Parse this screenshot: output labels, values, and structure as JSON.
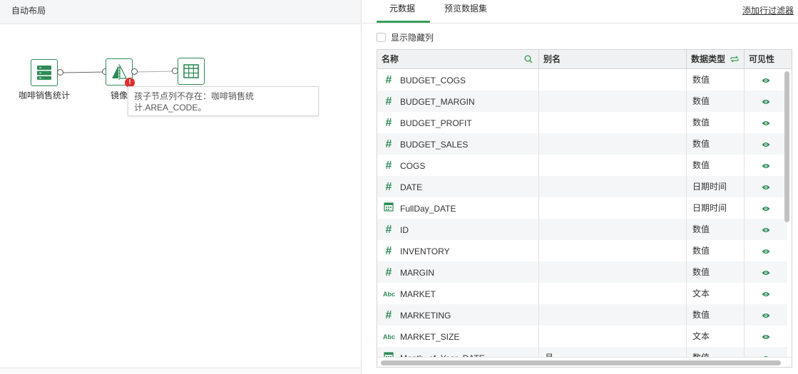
{
  "left_panel": {
    "title": "自动布局",
    "nodes": [
      {
        "label": "咖啡销售统计",
        "icon": "table-source-icon"
      },
      {
        "label": "镜像",
        "icon": "mirror-icon"
      },
      {
        "label": "",
        "icon": "output-table-icon"
      }
    ],
    "error_badge": "!",
    "tooltip": {
      "line1": "孩子节点列不存在：咖啡销售统",
      "line2": "计.AREA_CODE。"
    }
  },
  "right_panel": {
    "tabs": [
      {
        "label": "元数据",
        "active": true
      },
      {
        "label": "预览数据集",
        "active": false
      }
    ],
    "add_filter_link": "添加行过滤器",
    "show_hidden_label": "显示隐藏列",
    "table": {
      "headers": {
        "name": "名称",
        "alias": "别名",
        "type": "数据类型",
        "visible": "可见性"
      },
      "rows": [
        {
          "icon": "number",
          "name": "BUDGET_COGS",
          "alias": "",
          "type": "数值"
        },
        {
          "icon": "number",
          "name": "BUDGET_MARGIN",
          "alias": "",
          "type": "数值"
        },
        {
          "icon": "number",
          "name": "BUDGET_PROFIT",
          "alias": "",
          "type": "数值"
        },
        {
          "icon": "number",
          "name": "BUDGET_SALES",
          "alias": "",
          "type": "数值"
        },
        {
          "icon": "number",
          "name": "COGS",
          "alias": "",
          "type": "数值"
        },
        {
          "icon": "number",
          "name": "DATE",
          "alias": "",
          "type": "日期时间"
        },
        {
          "icon": "calendar",
          "name": "FullDay_DATE",
          "alias": "",
          "type": "日期时间"
        },
        {
          "icon": "number",
          "name": "ID",
          "alias": "",
          "type": "数值"
        },
        {
          "icon": "number",
          "name": "INVENTORY",
          "alias": "",
          "type": "数值"
        },
        {
          "icon": "number",
          "name": "MARGIN",
          "alias": "",
          "type": "数值"
        },
        {
          "icon": "text",
          "name": "MARKET",
          "alias": "",
          "type": "文本"
        },
        {
          "icon": "number",
          "name": "MARKETING",
          "alias": "",
          "type": "数值"
        },
        {
          "icon": "text",
          "name": "MARKET_SIZE",
          "alias": "",
          "type": "文本"
        },
        {
          "icon": "calendar",
          "name": "Month_of_Year_DATE",
          "alias": "月",
          "type": "数值"
        }
      ]
    }
  },
  "icon_glyphs": {
    "number": "#",
    "text": "Abc",
    "calendar": "calendar-icon",
    "visible": "eye-icon"
  },
  "colors": {
    "accent": "#36a05a",
    "node_border": "#2e8b57",
    "error": "#e03030",
    "header_bg": "#f0f1f2"
  }
}
